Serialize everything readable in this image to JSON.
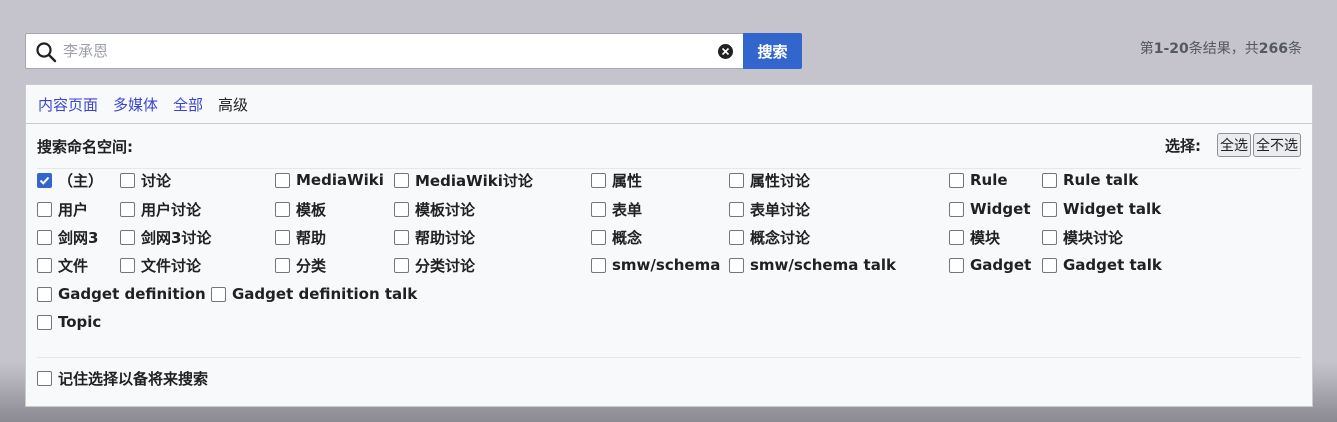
{
  "search": {
    "placeholder": "李承恩",
    "value": "",
    "button_label": "搜索"
  },
  "results": {
    "prefix": "第",
    "range": "1-20",
    "middle": "条结果，共",
    "total": "266",
    "suffix": "条"
  },
  "profile_tabs": [
    {
      "label": "内容页面",
      "active": false
    },
    {
      "label": "多媒体",
      "active": false
    },
    {
      "label": "全部",
      "active": false
    },
    {
      "label": "高级",
      "active": true
    }
  ],
  "namespace_section": {
    "title": "搜索命名空间:",
    "select_label": "选择:",
    "select_all": "全选",
    "select_none": "全不选"
  },
  "namespaces": [
    {
      "label": "（主）",
      "checked": true
    },
    {
      "label": "讨论",
      "checked": false
    },
    {
      "label": "MediaWiki",
      "checked": false
    },
    {
      "label": "MediaWiki讨论",
      "checked": false
    },
    {
      "label": "属性",
      "checked": false
    },
    {
      "label": "属性讨论",
      "checked": false
    },
    {
      "label": "Rule",
      "checked": false
    },
    {
      "label": "Rule talk",
      "checked": false
    },
    {
      "label": "用户",
      "checked": false
    },
    {
      "label": "用户讨论",
      "checked": false
    },
    {
      "label": "模板",
      "checked": false
    },
    {
      "label": "模板讨论",
      "checked": false
    },
    {
      "label": "表单",
      "checked": false
    },
    {
      "label": "表单讨论",
      "checked": false
    },
    {
      "label": "Widget",
      "checked": false
    },
    {
      "label": "Widget talk",
      "checked": false
    },
    {
      "label": "剑网3",
      "checked": false
    },
    {
      "label": "剑网3讨论",
      "checked": false
    },
    {
      "label": "帮助",
      "checked": false
    },
    {
      "label": "帮助讨论",
      "checked": false
    },
    {
      "label": "概念",
      "checked": false
    },
    {
      "label": "概念讨论",
      "checked": false
    },
    {
      "label": "模块",
      "checked": false
    },
    {
      "label": "模块讨论",
      "checked": false
    },
    {
      "label": "文件",
      "checked": false
    },
    {
      "label": "文件讨论",
      "checked": false
    },
    {
      "label": "分类",
      "checked": false
    },
    {
      "label": "分类讨论",
      "checked": false
    },
    {
      "label": "smw/schema",
      "checked": false
    },
    {
      "label": "smw/schema talk",
      "checked": false
    },
    {
      "label": "Gadget",
      "checked": false
    },
    {
      "label": "Gadget talk",
      "checked": false
    },
    {
      "label": "Gadget definition",
      "checked": false
    },
    {
      "label": "Gadget definition talk",
      "checked": false
    },
    {
      "label": "Topic",
      "checked": false
    }
  ],
  "remember": {
    "label": "记住选择以备将来搜索",
    "checked": false
  },
  "colors": {
    "accent": "#3366cc",
    "link": "#3a44d4"
  }
}
